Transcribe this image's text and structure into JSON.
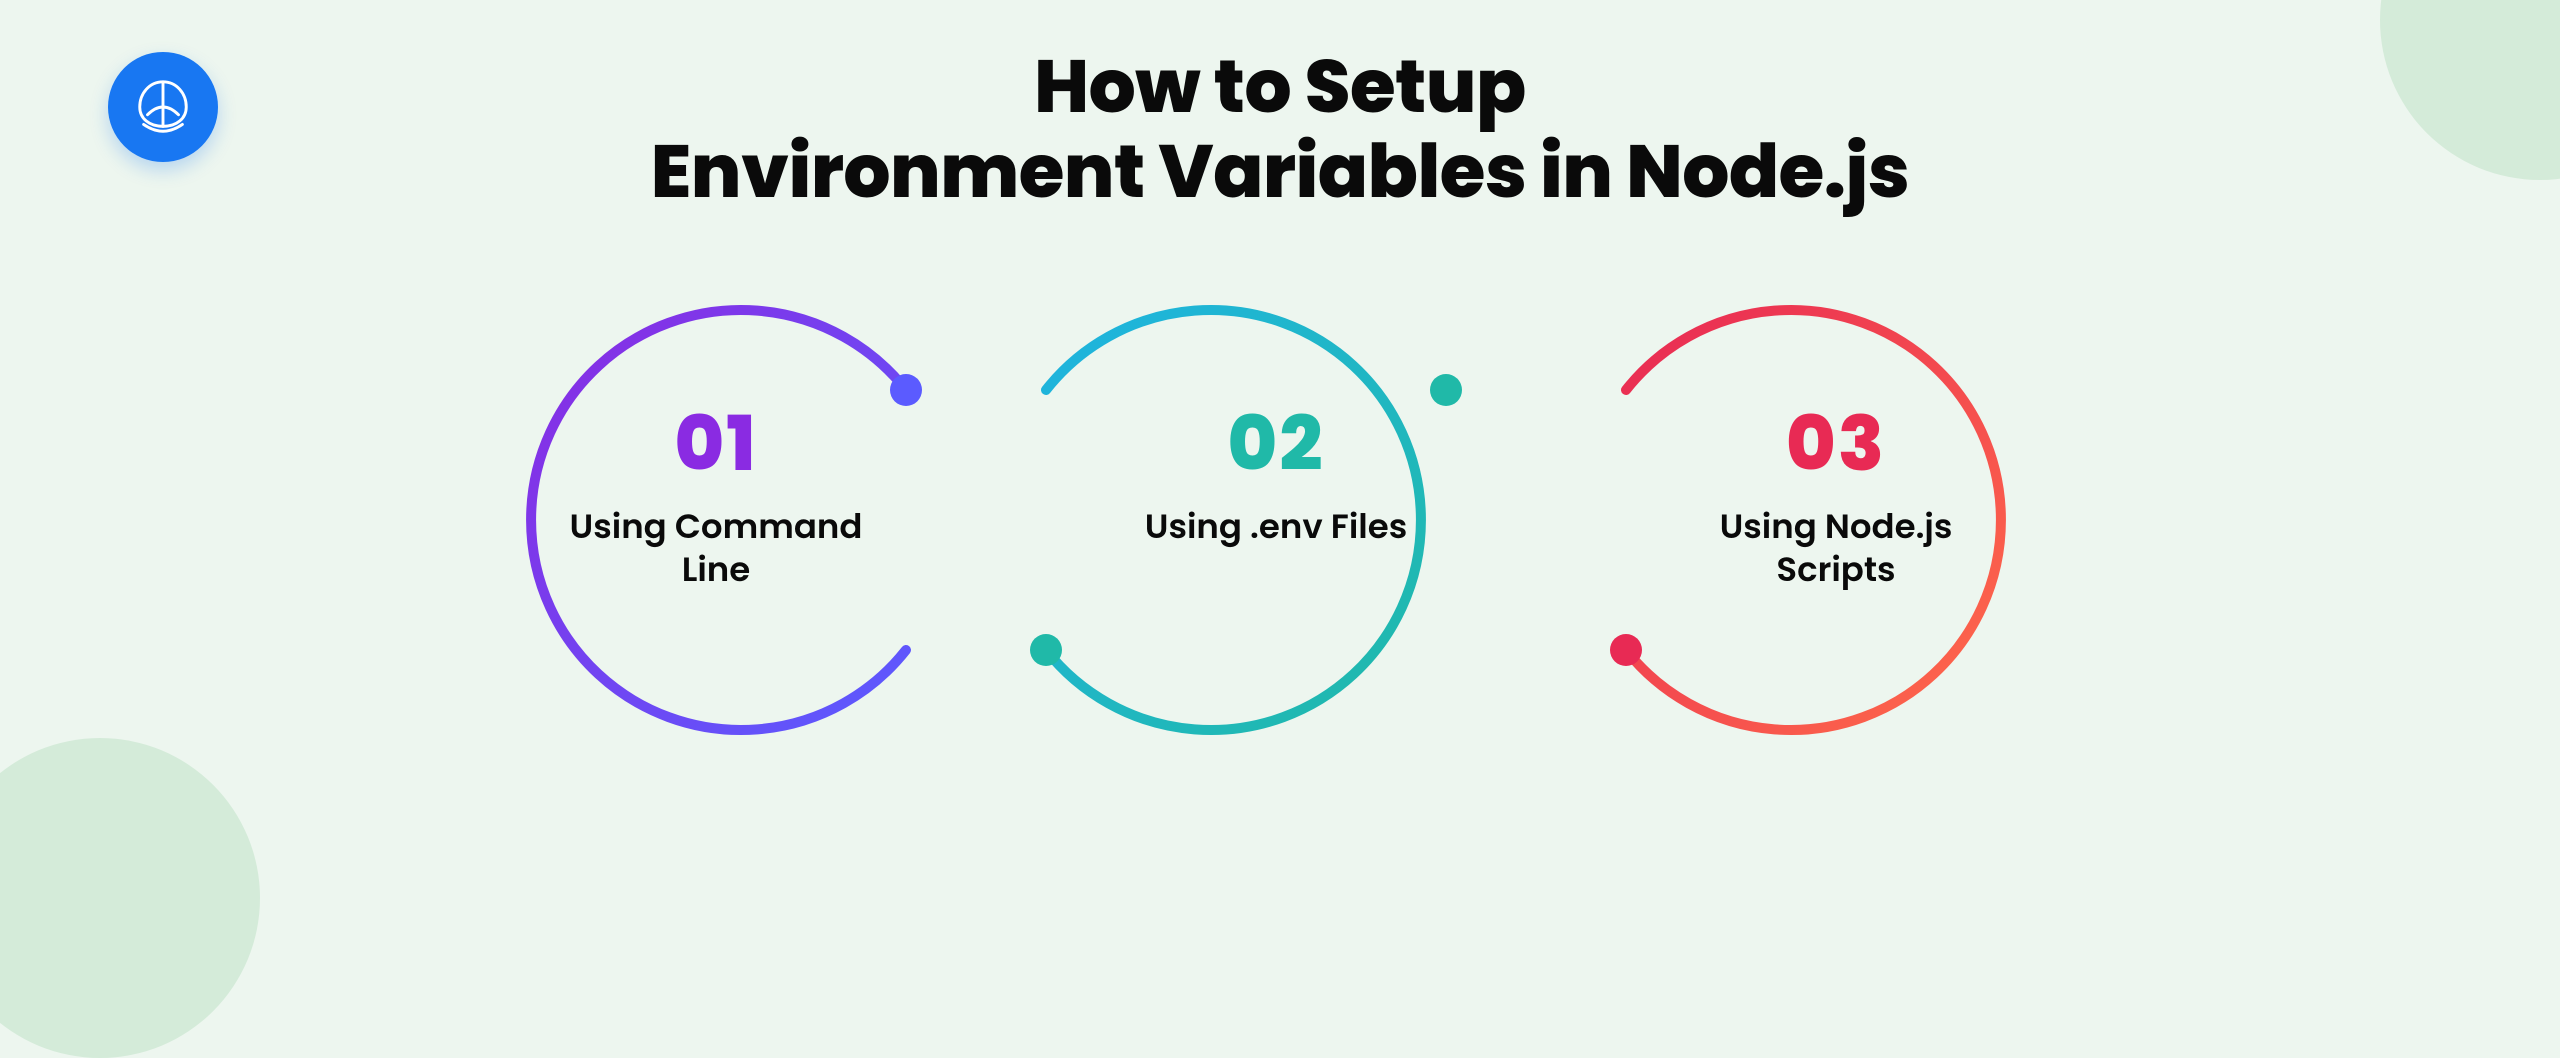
{
  "heading": {
    "line1": "How to Setup",
    "line2": "Environment Variables in Node.js"
  },
  "steps": [
    {
      "number": "01",
      "label_l1": "Using Command",
      "label_l2": "Line",
      "color": "#8a2be2"
    },
    {
      "number": "02",
      "label_l1": "Using .env Files",
      "label_l2": "",
      "color": "#20b9a8"
    },
    {
      "number": "03",
      "label_l1": "Using Node.js",
      "label_l2": "Scripts",
      "color": "#e82a54"
    }
  ],
  "logo": {
    "name": "brand-logo"
  }
}
